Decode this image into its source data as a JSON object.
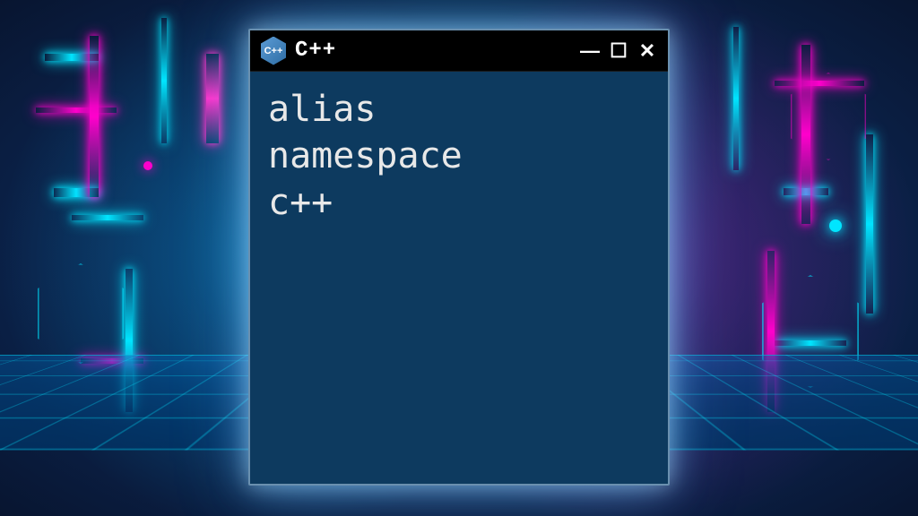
{
  "window": {
    "title": "C++",
    "icon_label": "C++",
    "controls": {
      "minimize": "—",
      "maximize": "☐",
      "close": "✕"
    }
  },
  "code": {
    "line1": "alias",
    "line2": "namespace",
    "line3": "c++"
  },
  "colors": {
    "terminal_bg": "#0d3a5f",
    "titlebar_bg": "#000000",
    "neon_cyan": "#00e5ff",
    "neon_pink": "#ff00cc"
  }
}
